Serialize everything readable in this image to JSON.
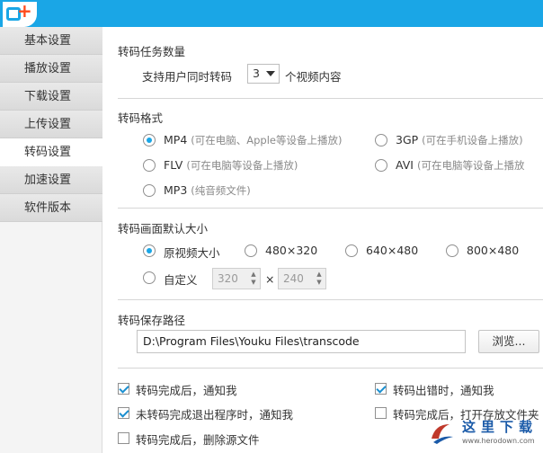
{
  "sidebar": {
    "items": [
      {
        "label": "基本设置"
      },
      {
        "label": "播放设置"
      },
      {
        "label": "下载设置"
      },
      {
        "label": "上传设置"
      },
      {
        "label": "转码设置",
        "active": true
      },
      {
        "label": "加速设置"
      },
      {
        "label": "软件版本"
      }
    ]
  },
  "task_count": {
    "title": "转码任务数量",
    "prefix": "支持用户同时转码",
    "value": "3",
    "suffix": "个视频内容"
  },
  "format": {
    "title": "转码格式",
    "options": [
      {
        "name": "MP4",
        "hint": "(可在电脑、Apple等设备上播放)",
        "checked": true
      },
      {
        "name": "3GP",
        "hint": "(可在手机设备上播放)",
        "checked": false
      },
      {
        "name": "FLV",
        "hint": "(可在电脑等设备上播放)",
        "checked": false
      },
      {
        "name": "AVI",
        "hint": "(可在电脑等设备上播放",
        "checked": false
      },
      {
        "name": "MP3",
        "hint": "(纯音频文件)",
        "checked": false
      }
    ]
  },
  "size": {
    "title": "转码画面默认大小",
    "options": [
      {
        "label": "原视频大小",
        "checked": true
      },
      {
        "label": "480×320",
        "checked": false
      },
      {
        "label": "640×480",
        "checked": false
      },
      {
        "label": "800×480",
        "checked": false
      }
    ],
    "custom_label": "自定义",
    "custom_width": "320",
    "times": "×",
    "custom_height": "240",
    "custom_checked": false
  },
  "path": {
    "title": "转码保存路径",
    "value": "D:\\Program Files\\Youku Files\\transcode",
    "browse": "浏览..."
  },
  "checks": [
    {
      "label": "转码完成后，通知我",
      "checked": true
    },
    {
      "label": "转码出错时，通知我",
      "checked": true
    },
    {
      "label": "未转码完成退出程序时，通知我",
      "checked": true
    },
    {
      "label": "转码完成后，打开存放文件夹",
      "checked": false
    },
    {
      "label": "转码完成后，删除源文件",
      "checked": false
    }
  ],
  "watermark": {
    "text": "这里下载",
    "url": "www.herodown.com"
  },
  "colors": {
    "accent": "#1aa6e6",
    "logo_plus": "#ff4a1c"
  }
}
